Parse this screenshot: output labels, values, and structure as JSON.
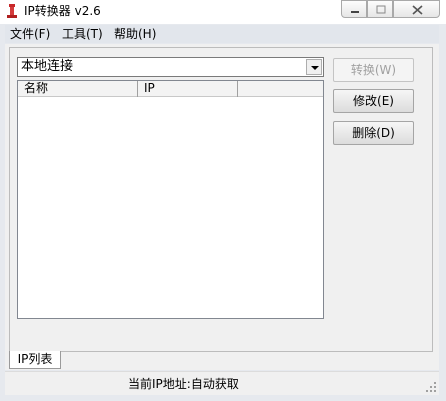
{
  "window": {
    "title": "IP转换器 v2.6"
  },
  "menu": [
    {
      "label": "文件(F)"
    },
    {
      "label": "工具(T)"
    },
    {
      "label": "帮助(H)"
    }
  ],
  "connection_select": {
    "selected": "本地连接"
  },
  "ip_list": {
    "columns": [
      "名称",
      "IP"
    ],
    "rows": []
  },
  "buttons": {
    "convert": "转换(W)",
    "edit": "修改(E)",
    "delete": "删除(D)"
  },
  "tabs": [
    {
      "label": "IP列表",
      "active": true
    }
  ],
  "status": {
    "text": "当前IP地址:自动获取"
  },
  "colors": {
    "app_icon": "#c8282a",
    "frame": "#e6e9ee"
  }
}
